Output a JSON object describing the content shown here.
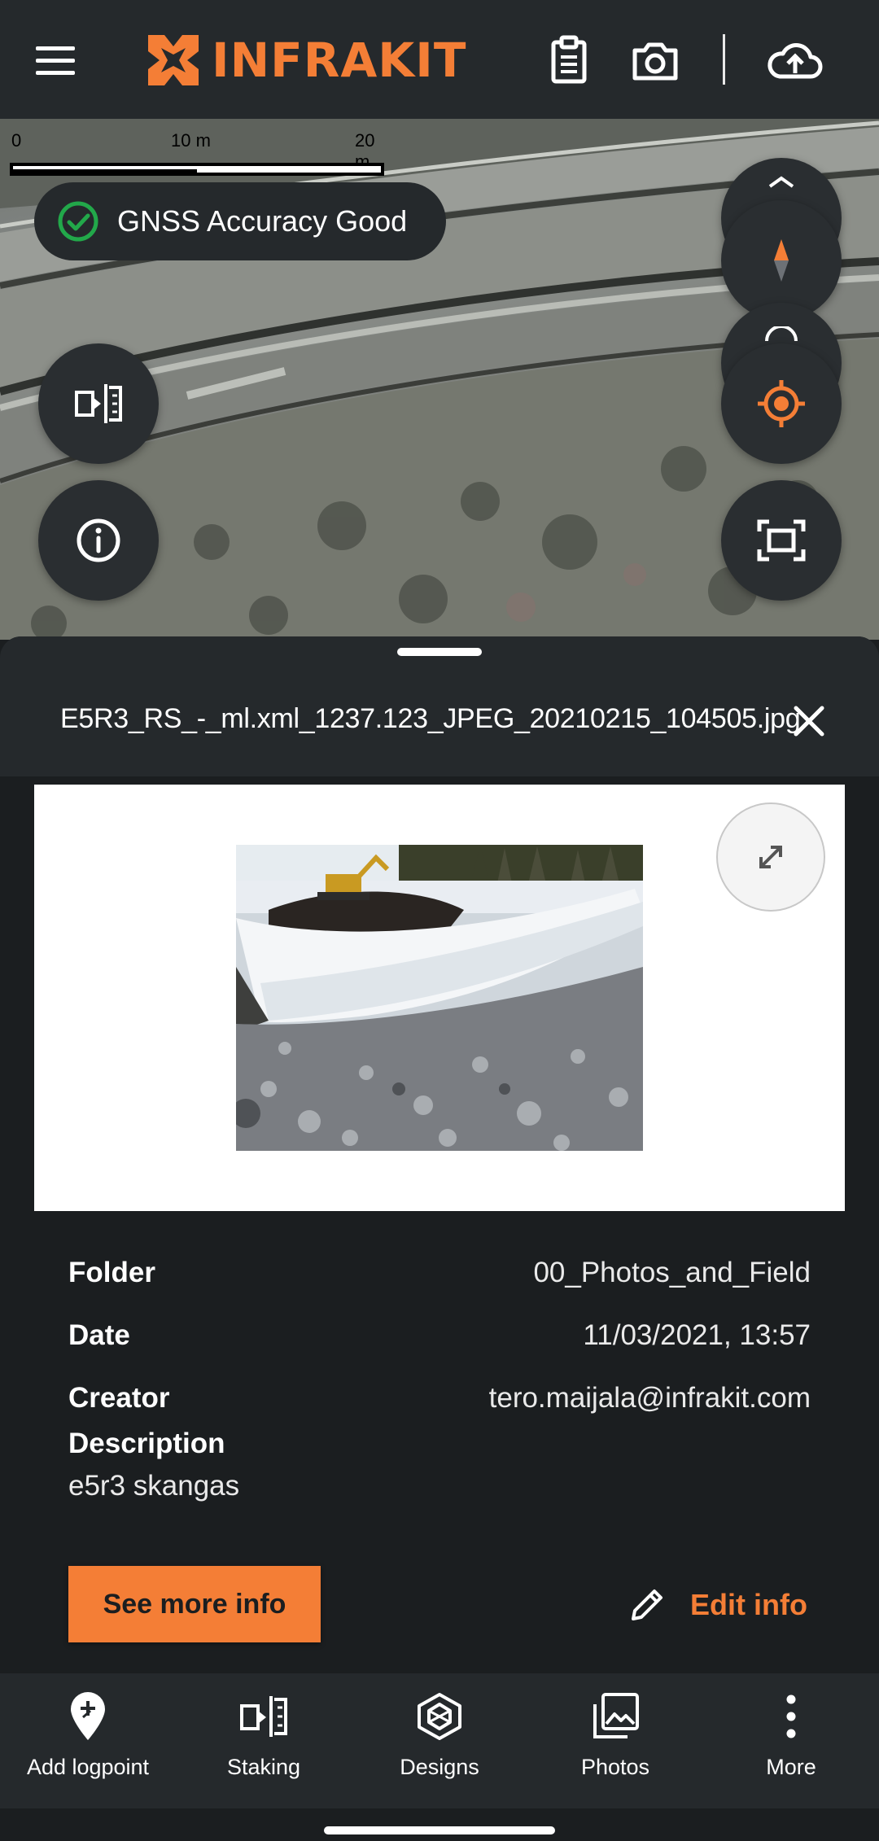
{
  "app": {
    "brand_name": "INFRAKIT",
    "brand_color": "#f47e36",
    "top_icons": [
      "menu-icon",
      "clipboard-icon",
      "camera-icon",
      "cloud-upload-icon"
    ]
  },
  "map": {
    "scale": {
      "start": "0",
      "mid": "10 m",
      "end": "20 m"
    },
    "gnss_status": "GNSS Accuracy Good",
    "status_color": "#22a84a",
    "left_buttons": [
      "staking-icon",
      "info-icon"
    ],
    "right_buttons": [
      "compass-icon",
      "locate-icon",
      "fit-bounds-icon"
    ]
  },
  "sheet": {
    "title": "E5R3_RS_-_ml.xml_1237.123_JPEG_20210215_104505.jpg",
    "details": [
      {
        "key": "Folder",
        "value": "00_Photos_and_Field"
      },
      {
        "key": "Date",
        "value": "11/03/2021, 13:57"
      },
      {
        "key": "Creator",
        "value": "tero.maijala@infrakit.com"
      }
    ],
    "description_label": "Description",
    "description_value": "e5r3 skangas",
    "see_more_label": "See more info",
    "edit_label": "Edit info"
  },
  "bottom_nav": [
    {
      "label": "Add logpoint",
      "icon": "add-logpoint-icon"
    },
    {
      "label": "Staking",
      "icon": "staking-icon"
    },
    {
      "label": "Designs",
      "icon": "designs-icon"
    },
    {
      "label": "Photos",
      "icon": "photos-icon"
    },
    {
      "label": "More",
      "icon": "more-vertical-icon"
    }
  ]
}
